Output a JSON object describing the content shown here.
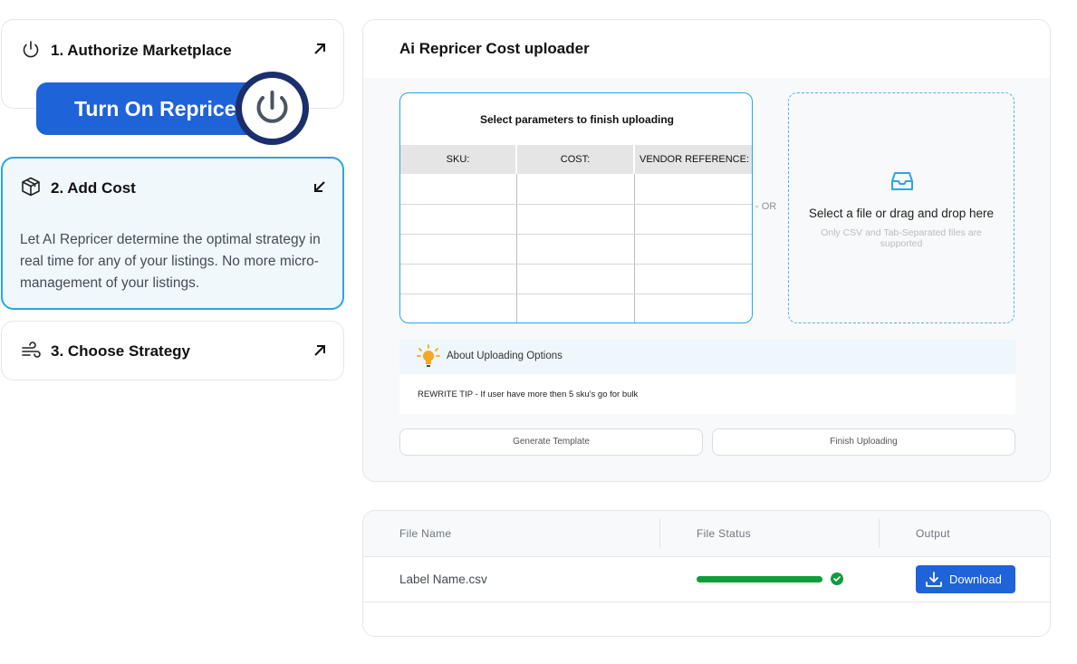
{
  "steps": [
    {
      "label": "1. Authorize Marketplace",
      "icon": "power-icon",
      "arrow": "arrow-up-right-icon"
    },
    {
      "label": "2. Add Cost",
      "icon": "box-icon",
      "arrow": "arrow-down-left-icon",
      "description": "Let AI Repricer determine the optimal strategy in real time for any of your listings. No more micro-management of your listings."
    },
    {
      "label": "3. Choose Strategy",
      "icon": "wind-icon",
      "arrow": "arrow-up-right-icon"
    }
  ],
  "turn_on_button": {
    "label": "Turn On Repricer",
    "icon": "power-icon"
  },
  "uploader": {
    "title": "Ai Repricer Cost uploader",
    "param_title": "Select parameters to finish uploading",
    "columns": [
      "SKU:",
      "COST:",
      "VENDOR REFERENCE:"
    ],
    "row_count": 5,
    "or_label": "- OR",
    "drop_main": "Select a file or drag and drop here",
    "drop_sub": "Only CSV and Tab-Separated files are supported",
    "about_label": "About Uploading Options",
    "tip": "REWRITE TIP - If user have more then 5 sku's go for bulk",
    "generate_label": "Generate Template",
    "finish_label": "Finish Uploading"
  },
  "files": {
    "headers": {
      "name": "File Name",
      "status": "File Status",
      "output": "Output"
    },
    "rows": [
      {
        "name": "Label Name.csv",
        "progress": 1.0,
        "status": "complete",
        "action": "Download"
      }
    ]
  },
  "colors": {
    "accent": "#1f63d8",
    "highlight": "#2aa5e6",
    "success": "#0f9d3a",
    "navy": "#1a2f6b"
  }
}
